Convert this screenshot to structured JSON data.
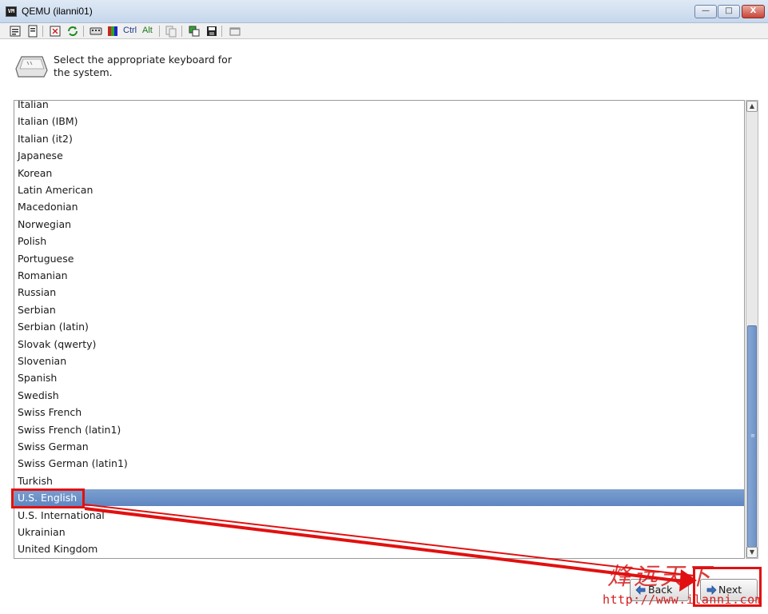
{
  "window": {
    "title": "QEMU (ilanni01)",
    "icon_label": "VM",
    "minimize": "—",
    "maximize": "□",
    "close": "X"
  },
  "toolbar": {
    "ctrl_label": "Ctrl",
    "alt_label": "Alt",
    "icons": [
      "properties-icon",
      "document-icon",
      "fullscreen-icon",
      "refresh-icon",
      "keyboard-icon",
      "color-icon",
      "copy-icon",
      "transfer-icon",
      "save-icon",
      "window-icon"
    ]
  },
  "header": {
    "instruction": "Select the appropriate keyboard for the system."
  },
  "keyboard_list": {
    "items": [
      "Italian",
      "Italian (IBM)",
      "Italian (it2)",
      "Japanese",
      "Korean",
      "Latin American",
      "Macedonian",
      "Norwegian",
      "Polish",
      "Portuguese",
      "Romanian",
      "Russian",
      "Serbian",
      "Serbian (latin)",
      "Slovak (qwerty)",
      "Slovenian",
      "Spanish",
      "Swedish",
      "Swiss French",
      "Swiss French (latin1)",
      "Swiss German",
      "Swiss German (latin1)",
      "Turkish",
      "U.S. English",
      "U.S. International",
      "Ukrainian",
      "United Kingdom"
    ],
    "selected": "U.S. English"
  },
  "scrollbar": {
    "up_arrow": "▲",
    "down_arrow": "▼",
    "grip": "≡",
    "position_fraction": 0.55
  },
  "buttons": {
    "back_label": "Back",
    "next_label": "Next"
  },
  "watermark": {
    "chinese": "烽远天下",
    "url": "http://www.ilanni.com"
  },
  "colors": {
    "selection": "#6a8fc7",
    "annotation": "#e21010"
  }
}
